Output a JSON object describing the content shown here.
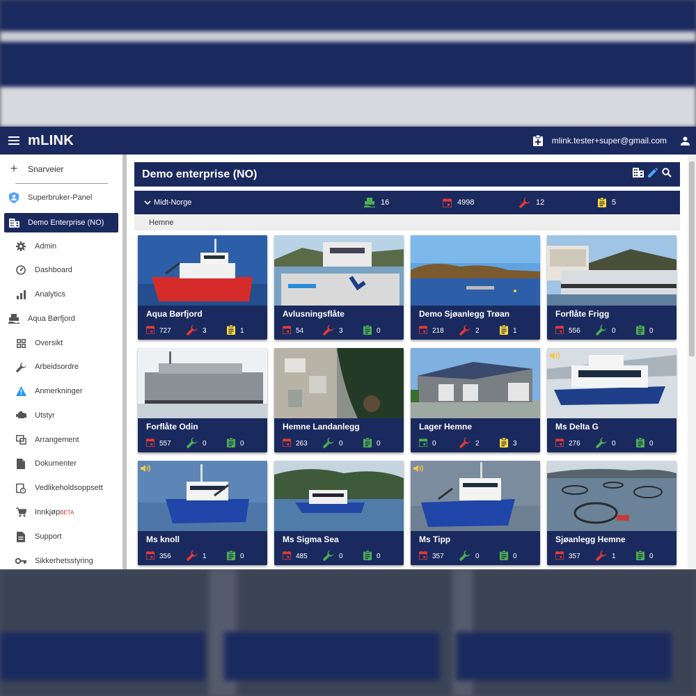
{
  "app": {
    "brand": "mLINK",
    "user_email": "mlink.tester+super@gmail.com"
  },
  "sidebar": {
    "shortcuts_label": "Snarveier",
    "items": [
      {
        "label": "Superbruker-Panel",
        "icon": "shield-user-icon",
        "level": 1
      },
      {
        "label": "Demo Enterprise (NO)",
        "icon": "enterprise-icon",
        "level": 1,
        "active": true
      },
      {
        "label": "Admin",
        "icon": "gear-icon",
        "level": 2
      },
      {
        "label": "Dashboard",
        "icon": "dashboard-icon",
        "level": 2
      },
      {
        "label": "Analytics",
        "icon": "bar-chart-icon",
        "level": 2
      },
      {
        "label": "Aqua Børfjord",
        "icon": "boat-icon",
        "level": 1
      },
      {
        "label": "Oversikt",
        "icon": "grid-icon",
        "level": 2
      },
      {
        "label": "Arbeidsordre",
        "icon": "wrench-icon",
        "level": 2
      },
      {
        "label": "Anmerkninger",
        "icon": "warning-icon",
        "level": 2
      },
      {
        "label": "Utstyr",
        "icon": "engine-icon",
        "level": 2
      },
      {
        "label": "Arrangement",
        "icon": "arrangement-icon",
        "level": 2
      },
      {
        "label": "Dokumenter",
        "icon": "document-icon",
        "level": 2
      },
      {
        "label": "Vedlikeholdsoppsett",
        "icon": "schedule-icon",
        "level": 2
      },
      {
        "label": "Innkjøp",
        "badge": "BETA",
        "icon": "cart-icon",
        "level": 2
      },
      {
        "label": "Support",
        "icon": "support-icon",
        "level": 2
      },
      {
        "label": "Sikkerhetsstyring",
        "icon": "key-icon",
        "level": 2
      }
    ]
  },
  "enterprise": {
    "title": "Demo enterprise (NO)"
  },
  "region": {
    "name": "Midt-Norge",
    "boats": "16",
    "calendar": "4998",
    "workorders": "12",
    "remarks": "5",
    "subregion": "Hemne"
  },
  "colors": {
    "navy": "#1b2a5e",
    "red": "#e53935",
    "green": "#4caf50",
    "yellow": "#fdd835"
  },
  "cards": [
    {
      "name": "Aqua Børfjord",
      "cal": "727",
      "wrench": "3",
      "wrench_color": "red",
      "rem": "1",
      "rem_color": "yellow",
      "cal_color": "red",
      "scene": "boat-red",
      "sound": false
    },
    {
      "name": "Avlusningsflåte",
      "cal": "54",
      "wrench": "3",
      "wrench_color": "red",
      "rem": "0",
      "rem_color": "green",
      "cal_color": "red",
      "scene": "deck",
      "sound": false
    },
    {
      "name": "Demo Sjøanlegg Trøan",
      "cal": "218",
      "wrench": "2",
      "wrench_color": "red",
      "rem": "1",
      "rem_color": "yellow",
      "cal_color": "red",
      "scene": "sea",
      "sound": false
    },
    {
      "name": "Forflåte Frigg",
      "cal": "556",
      "wrench": "0",
      "wrench_color": "green",
      "rem": "0",
      "rem_color": "green",
      "cal_color": "red",
      "scene": "barge-white",
      "sound": false
    },
    {
      "name": "Forflåte Odin",
      "cal": "557",
      "wrench": "0",
      "wrench_color": "green",
      "rem": "0",
      "rem_color": "green",
      "cal_color": "red",
      "scene": "barge-grey",
      "sound": false
    },
    {
      "name": "Hemne Landanlegg",
      "cal": "263",
      "wrench": "0",
      "wrench_color": "green",
      "rem": "0",
      "rem_color": "green",
      "cal_color": "red",
      "scene": "aerial",
      "sound": false
    },
    {
      "name": "Lager Hemne",
      "cal": "0",
      "wrench": "2",
      "wrench_color": "red",
      "rem": "3",
      "rem_color": "yellow",
      "cal_color": "green",
      "scene": "warehouse",
      "sound": false
    },
    {
      "name": "Ms Delta G",
      "cal": "276",
      "wrench": "0",
      "wrench_color": "green",
      "rem": "0",
      "rem_color": "green",
      "cal_color": "red",
      "scene": "catamaran",
      "sound": true
    },
    {
      "name": "Ms knoll",
      "cal": "356",
      "wrench": "1",
      "wrench_color": "red",
      "rem": "0",
      "rem_color": "green",
      "cal_color": "red",
      "scene": "boat-blue",
      "sound": true
    },
    {
      "name": "Ms Sigma Sea",
      "cal": "485",
      "wrench": "0",
      "wrench_color": "green",
      "rem": "0",
      "rem_color": "green",
      "cal_color": "red",
      "scene": "boat-fjord",
      "sound": false
    },
    {
      "name": "Ms Tipp",
      "cal": "357",
      "wrench": "0",
      "wrench_color": "green",
      "rem": "0",
      "rem_color": "green",
      "cal_color": "red",
      "scene": "boat-blue2",
      "sound": true
    },
    {
      "name": "Sjøanlegg Hemne",
      "cal": "357",
      "wrench": "1",
      "wrench_color": "red",
      "rem": "0",
      "rem_color": "green",
      "cal_color": "red",
      "scene": "fishfarm",
      "sound": false
    }
  ]
}
